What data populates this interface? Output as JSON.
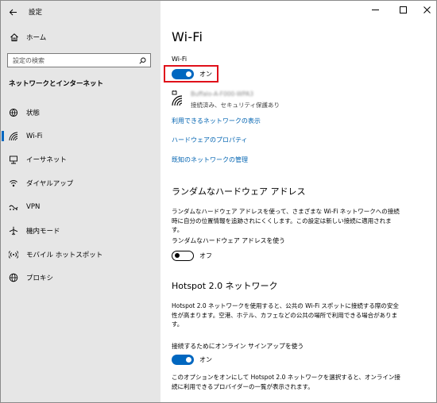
{
  "window": {
    "title": "設定"
  },
  "sidebar": {
    "home_label": "ホーム",
    "search_placeholder": "設定の検索",
    "section_title": "ネットワークとインターネット",
    "items": [
      {
        "label": "状態",
        "icon": "home-globe-icon"
      },
      {
        "label": "Wi-Fi",
        "icon": "wifi-icon",
        "active": true
      },
      {
        "label": "イーサネット",
        "icon": "ethernet-icon"
      },
      {
        "label": "ダイヤルアップ",
        "icon": "dialup-icon"
      },
      {
        "label": "VPN",
        "icon": "vpn-icon"
      },
      {
        "label": "機内モード",
        "icon": "airplane-icon"
      },
      {
        "label": "モバイル ホットスポット",
        "icon": "hotspot-icon"
      },
      {
        "label": "プロキシ",
        "icon": "globe-icon"
      }
    ]
  },
  "main": {
    "page_title": "Wi-Fi",
    "wifi_label": "Wi-Fi",
    "wifi_toggle_state": "オン",
    "network": {
      "name": "Buffalo-A-F000-WPA3",
      "status": "接続済み、セキュリティ保護あり"
    },
    "links": {
      "show_available": "利用できるネットワークの表示",
      "hardware_props": "ハードウェアのプロパティ",
      "manage_known": "既知のネットワークの管理"
    },
    "random_hw": {
      "heading": "ランダムなハードウェア アドレス",
      "desc": "ランダムなハードウェア アドレスを使って、さまざまな Wi-Fi ネットワークへの接続時に自分の位置情報を追跡されにくくします。この設定は新しい接続に適用されます。",
      "option_label": "ランダムなハードウェア アドレスを使う",
      "toggle_state": "オフ"
    },
    "hotspot": {
      "heading": "Hotspot 2.0 ネットワーク",
      "desc": "Hotspot 2.0 ネットワークを使用すると、公共の Wi-Fi スポットに接続する際の安全性が高まります。空港、ホテル、カフェなどの公共の場所で利用できる場合があります。",
      "option_label": "接続するためにオンライン サインアップを使う",
      "toggle_state": "オン",
      "footer": "このオプションをオンにして Hotspot 2.0 ネットワークを選択すると、オンライン接続に利用できるプロバイダーの一覧が表示されます。"
    }
  },
  "colors": {
    "accent": "#0067c0",
    "link": "#0063b1",
    "highlight": "#e0101a",
    "sidebar_bg": "#e6e6e6"
  }
}
